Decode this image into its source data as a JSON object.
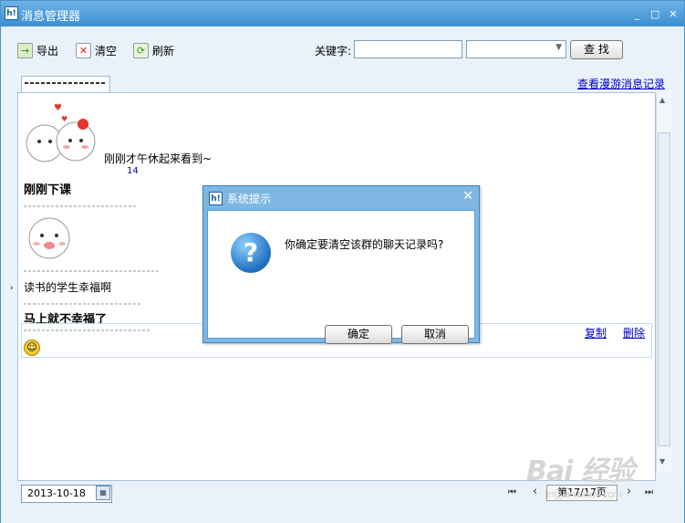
{
  "window": {
    "title": "消息管理器",
    "min": "_",
    "max": "□",
    "close": "✕"
  },
  "toolbar": {
    "export_label": "导出",
    "clear_label": "清空",
    "refresh_label": "刷新",
    "keyword_label": "关键字:",
    "keyword_value": "",
    "search_label": "查 找"
  },
  "tabs": {
    "roam_link": "查看漫游消息记录"
  },
  "messages": {
    "m1_text": "刚刚才午休起来看到~",
    "m1_num": "14",
    "m2_text": "刚刚下课",
    "m3_text": "读书的学生幸福啊",
    "m4_text": "马上就不幸福了"
  },
  "row_actions": {
    "copy": "复制",
    "delete": "删除"
  },
  "footer": {
    "date": "2013-10-18",
    "first": "⏮",
    "prev": "‹",
    "page": "第17/17页",
    "next": "›",
    "last": "⏭"
  },
  "dialog": {
    "title": "系统提示",
    "message": "你确定要清空该群的聊天记录吗?",
    "ok": "确定",
    "cancel": "取消"
  },
  "watermark": {
    "text": "Bai 经验",
    "sub": "jingyan.baidu.com"
  }
}
